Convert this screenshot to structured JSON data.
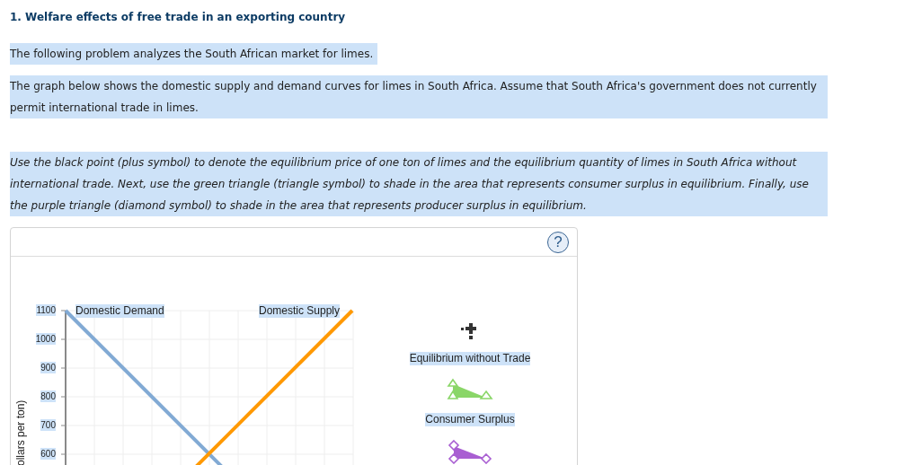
{
  "title": "1. Welfare effects of free trade in an exporting country",
  "paragraphs": [
    {
      "text": "The following problem analyzes the South African market for limes.",
      "italic": false
    },
    {
      "text": "The graph below shows the domestic supply and demand curves for limes in South Africa. Assume that South Africa's government does not currently permit international trade in limes.",
      "italic": false
    },
    {
      "text": "Use the black point (plus symbol) to denote the equilibrium price of one ton of limes and the equilibrium quantity of limes in South Africa without international trade. Next, use the green triangle (triangle symbol) to shade in the area that represents consumer surplus in equilibrium. Finally, use the purple triangle (diamond symbol) to shade in the area that represents producer surplus in equilibrium.",
      "italic": true
    }
  ],
  "graph": {
    "help_button": "?",
    "y_axis_title": "ollars per ton)",
    "y_ticks": [
      "1100",
      "1000",
      "900",
      "800",
      "700",
      "600"
    ],
    "curves": [
      {
        "kind": "demand",
        "label": "Domestic Demand",
        "color": "#82aad4"
      },
      {
        "kind": "supply",
        "label": "Domestic Supply",
        "color": "#ff9900"
      }
    ],
    "tools": [
      {
        "kind": "point",
        "label": "Equilibrium without Trade"
      },
      {
        "kind": "triangle",
        "label": "Consumer Surplus",
        "color": "#8ad668"
      },
      {
        "kind": "diamond",
        "color": "#a95fd2"
      }
    ]
  }
}
